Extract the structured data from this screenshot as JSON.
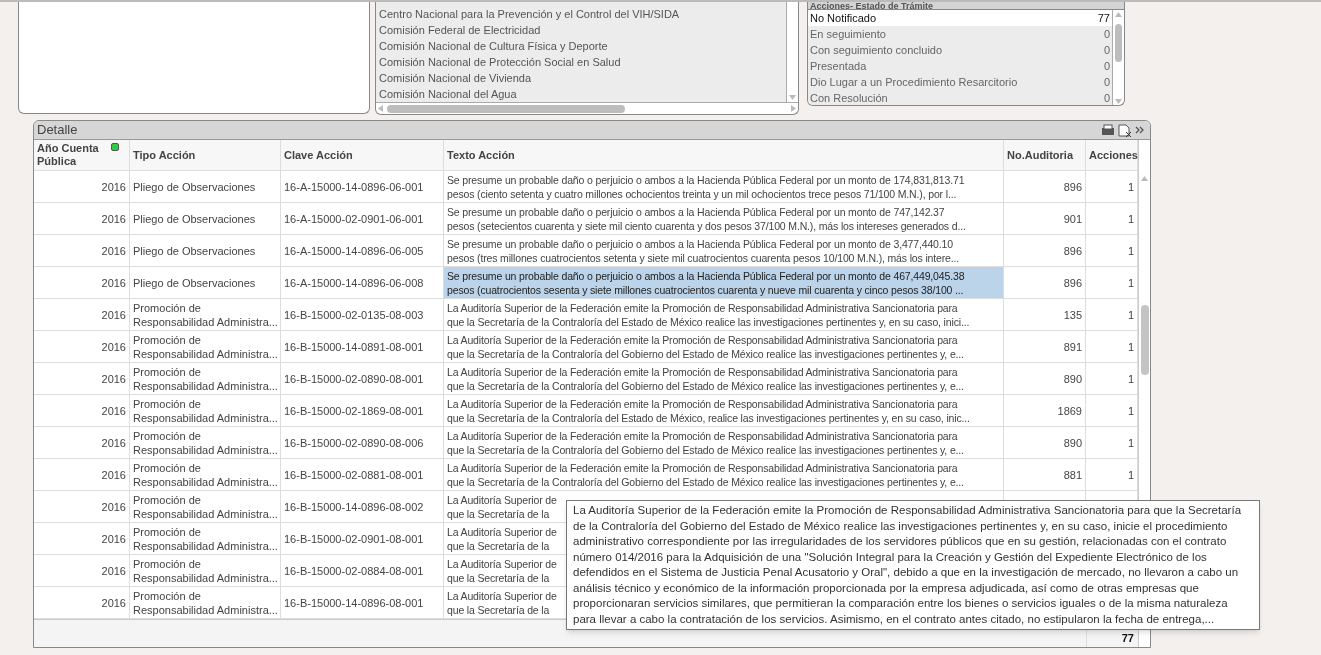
{
  "entity_list": {
    "items": [
      {
        "label": "Centro Nacional para la Prevención y el Control del VIH/SIDA"
      },
      {
        "label": "Comisión Federal de Electricidad"
      },
      {
        "label": "Comisión Nacional de Cultura Física y Deporte"
      },
      {
        "label": "Comisión Nacional de Protección Social en Salud"
      },
      {
        "label": "Comisión Nacional de Vivienda"
      },
      {
        "label": "Comisión Nacional del Agua"
      }
    ]
  },
  "status_list": {
    "title": "Acciones- Estado de Trámite",
    "items": [
      {
        "label": "No Notificado",
        "count": "77",
        "selected": true
      },
      {
        "label": "En seguimiento",
        "count": "0",
        "selected": false
      },
      {
        "label": "Con seguimiento concluido",
        "count": "0",
        "selected": false
      },
      {
        "label": "Presentada",
        "count": "0",
        "selected": false
      },
      {
        "label": "Dio Lugar a un Procedimiento Resarcitorio",
        "count": "0",
        "selected": false
      },
      {
        "label": "Con Resolución",
        "count": "0",
        "selected": false
      }
    ]
  },
  "detail": {
    "title": "Detalle",
    "columns": [
      "Año Cuenta Pública",
      "Tipo Acción",
      "Clave Acción",
      "Texto Acción",
      "No.Auditoria",
      "Acciones"
    ],
    "rows": [
      {
        "year": "2016",
        "type": [
          "Pliego de Observaciones"
        ],
        "key": "16-A-15000-14-0896-06-001",
        "text": [
          "Se presume un probable daño o perjuicio o ambos a la Hacienda Pública Federal por un monto de 174,831,813.71",
          "pesos (ciento setenta y cuatro millones ochocientos treinta y un mil ochocientos trece pesos 71/100 M.N.), por l..."
        ],
        "audit": "896",
        "actions": "1",
        "selected": false
      },
      {
        "year": "2016",
        "type": [
          "Pliego de Observaciones"
        ],
        "key": "16-A-15000-02-0901-06-001",
        "text": [
          "Se presume un probable daño o perjuicio o ambos a la Hacienda Pública Federal por un monto de 747,142.37",
          "pesos (setecientos cuarenta y siete mil ciento cuarenta y dos pesos 37/100 M.N.), más los intereses generados d..."
        ],
        "audit": "901",
        "actions": "1",
        "selected": false
      },
      {
        "year": "2016",
        "type": [
          "Pliego de Observaciones"
        ],
        "key": "16-A-15000-14-0896-06-005",
        "text": [
          "Se presume un probable daño o perjuicio o ambos a la Hacienda Pública Federal por un monto de 3,477,440.10",
          "pesos (tres millones cuatrocientos setenta y siete mil cuatrocientos cuarenta pesos 10/100 M.N.), más los intere..."
        ],
        "audit": "896",
        "actions": "1",
        "selected": false
      },
      {
        "year": "2016",
        "type": [
          "Pliego de Observaciones"
        ],
        "key": "16-A-15000-14-0896-06-008",
        "text": [
          "Se presume un probable daño o perjuicio o ambos a la Hacienda Pública Federal por un monto de 467,449,045.38",
          "pesos (cuatrocientos sesenta y siete millones cuatrocientos cuarenta y nueve mil cuarenta y cinco pesos 38/100 ..."
        ],
        "audit": "896",
        "actions": "1",
        "selected": true
      },
      {
        "year": "2016",
        "type": [
          "Promoción de",
          "Responsabilidad Administra..."
        ],
        "key": "16-B-15000-02-0135-08-003",
        "text": [
          "La Auditoría Superior de la Federación emite la Promoción de Responsabilidad Administrativa Sancionatoria para",
          "que la Secretaría de la Contraloría del Estado de México realice las investigaciones pertinentes y, en su caso, inici..."
        ],
        "audit": "135",
        "actions": "1",
        "selected": false
      },
      {
        "year": "2016",
        "type": [
          "Promoción de",
          "Responsabilidad Administra..."
        ],
        "key": "16-B-15000-14-0891-08-001",
        "text": [
          "La Auditoría Superior de la Federación emite la Promoción de Responsabilidad Administrativa Sancionatoria para",
          "que la Secretaría de la Contraloría del Gobierno del Estado de México realice las investigaciones pertinentes y, e..."
        ],
        "audit": "891",
        "actions": "1",
        "selected": false
      },
      {
        "year": "2016",
        "type": [
          "Promoción de",
          "Responsabilidad Administra..."
        ],
        "key": "16-B-15000-02-0890-08-001",
        "text": [
          "La Auditoría Superior de la Federación emite la Promoción de Responsabilidad Administrativa Sancionatoria para",
          "que la Secretaría de la Contraloría del Gobierno del Estado de México realice las investigaciones pertinentes y, e..."
        ],
        "audit": "890",
        "actions": "1",
        "selected": false
      },
      {
        "year": "2016",
        "type": [
          "Promoción de",
          "Responsabilidad Administra..."
        ],
        "key": "16-B-15000-02-1869-08-001",
        "text": [
          "La Auditoría Superior de la Federación emite la Promoción de Responsabilidad Administrativa Sancionatoria para",
          "que la Secretaría de la Contraloría del Estado de México, realice las investigaciones pertinentes y, en su caso, inic..."
        ],
        "audit": "1869",
        "actions": "1",
        "selected": false
      },
      {
        "year": "2016",
        "type": [
          "Promoción de",
          "Responsabilidad Administra..."
        ],
        "key": "16-B-15000-02-0890-08-006",
        "text": [
          "La Auditoría Superior de la Federación emite la Promoción de Responsabilidad Administrativa Sancionatoria para",
          "que la Secretaría de la Contraloría del Gobierno del Estado de México realice las investigaciones pertinentes y, e..."
        ],
        "audit": "890",
        "actions": "1",
        "selected": false
      },
      {
        "year": "2016",
        "type": [
          "Promoción de",
          "Responsabilidad Administra..."
        ],
        "key": "16-B-15000-02-0881-08-001",
        "text": [
          "La Auditoría Superior de la Federación emite la Promoción de Responsabilidad Administrativa Sancionatoria para",
          "que la Secretaría de la Contraloría del Gobierno del Estado de México realice las investigaciones pertinentes y, e..."
        ],
        "audit": "881",
        "actions": "1",
        "selected": false
      },
      {
        "year": "2016",
        "type": [
          "Promoción de",
          "Responsabilidad Administra..."
        ],
        "key": "16-B-15000-14-0896-08-002",
        "text": [
          "La Auditoría Superior de",
          "que la Secretaría de la"
        ],
        "selected": false
      },
      {
        "year": "2016",
        "type": [
          "Promoción de",
          "Responsabilidad Administra..."
        ],
        "key": "16-B-15000-02-0901-08-001",
        "text": [
          "La Auditoría Superior de",
          "que la Secretaría de la"
        ],
        "selected": false
      },
      {
        "year": "2016",
        "type": [
          "Promoción de",
          "Responsabilidad Administra..."
        ],
        "key": "16-B-15000-02-0884-08-001",
        "text": [
          "La Auditoría Superior de",
          "que la Secretaría de la"
        ],
        "selected": false
      },
      {
        "year": "2016",
        "type": [
          "Promoción de",
          "Responsabilidad Administra..."
        ],
        "key": "16-B-15000-14-0896-08-001",
        "text": [
          "La Auditoría Superior de",
          "que la Secretaría de la"
        ],
        "selected": false
      }
    ],
    "total_actions": "77"
  },
  "tooltip": {
    "text": "La Auditoría Superior de la Federación emite la Promoción de Responsabilidad Administrativa Sancionatoria para que la Secretaría de la Contraloría del Gobierno del Estado de México realice las investigaciones pertinentes y, en su caso, inicie el procedimiento administrativo correspondiente por las irregularidades de los servidores públicos que en su gestión, relacionadas con el contrato número 014/2016 para la Adquisición de una \"Solución Integral para la Creación y Gestión del Expediente Electrónico de los defendidos en el Sistema de Justicia Penal Acusatorio y Oral\", debido a que en la investigación de mercado, no llevaron a cabo un análisis técnico y económico de la información proporcionada por la empresa adjudicada, así como de otras empresas que proporcionaran servicios similares, que permitieran la comparación entre los bienes o servicios iguales o de la misma naturaleza para llevar a cabo la contratación de los servicios. Asimismo, en el contrato antes citado, no estipularon la fecha de entrega,..."
  }
}
